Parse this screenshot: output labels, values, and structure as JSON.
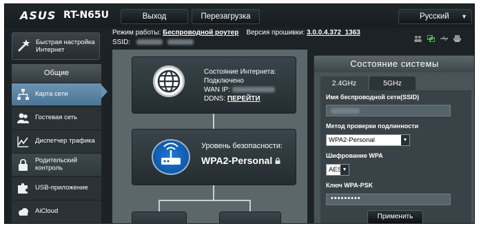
{
  "header": {
    "logo": "ASUS",
    "model": "RT-N65U",
    "exit_label": "Выход",
    "reboot_label": "Перезагрузка",
    "language": "Русский"
  },
  "info": {
    "mode_label": "Режим работы:",
    "mode_value": "Беспроводной роутер",
    "firmware_label": "Версия прошивки:",
    "firmware_value": "3.0.0.4.372_1363",
    "ssid_label": "SSID:"
  },
  "sidebar": {
    "quick_setup": "Быстрая настройка Интернет",
    "section_title": "Общие",
    "items": [
      {
        "label": "Карта сети",
        "icon": "network-map-icon",
        "active": true
      },
      {
        "label": "Гостевая сеть",
        "icon": "guest-network-icon",
        "active": false
      },
      {
        "label": "Диспетчер трафика",
        "icon": "traffic-manager-icon",
        "active": false
      },
      {
        "label": "Родительский контроль",
        "icon": "parental-control-icon",
        "active": false
      },
      {
        "label": "USB-приложение",
        "icon": "puzzle-icon",
        "active": false
      },
      {
        "label": "AiCloud",
        "icon": "cloud-icon",
        "active": false
      }
    ]
  },
  "network_map": {
    "internet_status_label": "Состояние Интернета:",
    "internet_status_value": "Подключено",
    "wan_ip_label": "WAN IP:",
    "ddns_label": "DDNS:",
    "ddns_link": "ПЕРЕЙТИ",
    "security_label": "Уровень безопасности:",
    "security_value": "WPA2-Personal"
  },
  "system_status": {
    "title": "Состояние системы",
    "tabs": [
      "2.4GHz",
      "5GHz"
    ],
    "active_tab": "2.4GHz",
    "ssid_label": "Имя беспроводной сети(SSID)",
    "auth_label": "Метод проверки подлинности",
    "auth_value": "WPA2-Personal",
    "encryption_label": "Шифрование WPA",
    "encryption_value": "AES",
    "psk_label": "Ключ WPA-PSK",
    "psk_value": "•••••••••",
    "apply_label": "Применить"
  },
  "colors": {
    "background": "#1c2226",
    "sidebar_active": "#6c93b2",
    "map_background": "#5c676c",
    "status_green": "#56d24a"
  }
}
